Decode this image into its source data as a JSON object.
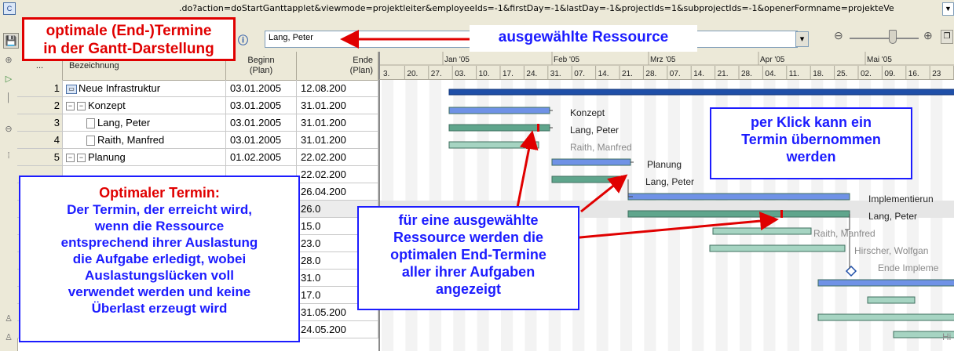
{
  "window": {
    "url": ".do?action=doStartGanttapplet&viewmode=projektleiter&employeeIds=-1&firstDay=-1&lastDay=-1&projectIds=1&subprojectIds=-1&openerFormname=projekteVe"
  },
  "toolbar": {
    "resource_value": "Lang, Peter"
  },
  "table": {
    "col_more": "...",
    "col_name": "Bezeichnung",
    "col_begin": "Beginn\n(Plan)",
    "col_end": "Ende\n(Plan)",
    "rows": [
      {
        "num": "1",
        "name": "Neue Infrastruktur",
        "begin": "03.01.2005",
        "end": "12.08.200"
      },
      {
        "num": "2",
        "name": "Konzept",
        "begin": "03.01.2005",
        "end": "31.01.200"
      },
      {
        "num": "3",
        "name": "Lang, Peter",
        "begin": "03.01.2005",
        "end": "31.01.200"
      },
      {
        "num": "4",
        "name": "Raith, Manfred",
        "begin": "03.01.2005",
        "end": "31.01.200"
      },
      {
        "num": "5",
        "name": "Planung",
        "begin": "01.02.2005",
        "end": "22.02.200"
      },
      {
        "num": "",
        "name": "",
        "begin": "",
        "end": "22.02.200"
      },
      {
        "num": "",
        "name": "",
        "begin": "",
        "end": "26.04.200"
      },
      {
        "num": "",
        "name": "",
        "begin": "",
        "end": "26.0"
      },
      {
        "num": "",
        "name": "",
        "begin": "",
        "end": "15.0"
      },
      {
        "num": "",
        "name": "",
        "begin": "",
        "end": "23.0"
      },
      {
        "num": "",
        "name": "",
        "begin": "",
        "end": "28.0"
      },
      {
        "num": "",
        "name": "",
        "begin": "",
        "end": "31.0"
      },
      {
        "num": "",
        "name": "",
        "begin": "",
        "end": "17.0"
      },
      {
        "num": "",
        "name": "",
        "begin": "",
        "end": "31.05.200"
      },
      {
        "num": "",
        "name": "",
        "begin": "",
        "end": "24.05.200"
      }
    ]
  },
  "gantt": {
    "months": [
      "Jan '05",
      "Feb '05",
      "Mrz '05",
      "Apr '05",
      "Mai '05"
    ],
    "weeks": [
      "3.",
      "20.",
      "27.",
      "03.",
      "10.",
      "17.",
      "24.",
      "31.",
      "07.",
      "14.",
      "21.",
      "28.",
      "07.",
      "14.",
      "21.",
      "28.",
      "04.",
      "11.",
      "18.",
      "25.",
      "02.",
      "09.",
      "16.",
      "23"
    ],
    "labels": [
      "Konzept",
      "Lang, Peter",
      "Raith, Manfred",
      "Planung",
      "Lang, Peter",
      "Implementierun",
      "Lang, Peter",
      "Raith, Manfred",
      "Hirscher, Wolfgan",
      "Ende Impleme",
      "Hi"
    ],
    "colors": {
      "summary": "#1f4fa8",
      "blue": "#6f92e6",
      "green": "#5fa58c",
      "lightgreen": "#a6d4c2",
      "marker": "#e00000"
    }
  },
  "callouts": {
    "title_line1": "optimale (End-)Termine",
    "title_line2": "in der Gantt-Darstellung",
    "resource": "ausgewählte Ressource",
    "opt_title": "Optimaler Termin:",
    "opt_lines": [
      "Der Termin, der erreicht wird,",
      "wenn die Ressource",
      "entsprechend ihrer Auslastung",
      "die Aufgabe erledigt, wobei",
      "Auslastungslücken voll",
      "verwendet werden und keine",
      "Überlast erzeugt wird"
    ],
    "klick_lines": [
      "per Klick kann ein",
      "Termin übernommen",
      "werden"
    ],
    "mid_lines": [
      "für eine ausgewählte",
      "Ressource werden die",
      "optimalen End-Termine",
      "aller ihrer Aufgaben",
      "angezeigt"
    ]
  }
}
